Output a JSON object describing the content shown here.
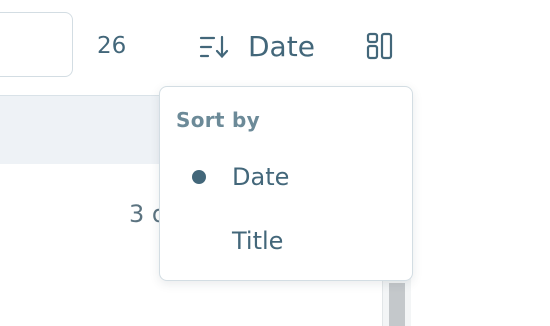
{
  "toolbar": {
    "count": "26",
    "sort_icon": "sort-descending-icon",
    "sort_label": "Date",
    "layout_icon": "layout-grid-icon"
  },
  "content": {
    "row_text": "3 d"
  },
  "sort_menu": {
    "heading": "Sort by",
    "options": [
      {
        "label": "Date",
        "selected": true
      },
      {
        "label": "Title",
        "selected": false
      }
    ]
  },
  "colors": {
    "accent": "#43677a",
    "muted": "#6c8a98",
    "border": "#d3dde3",
    "band": "#eef2f6"
  }
}
